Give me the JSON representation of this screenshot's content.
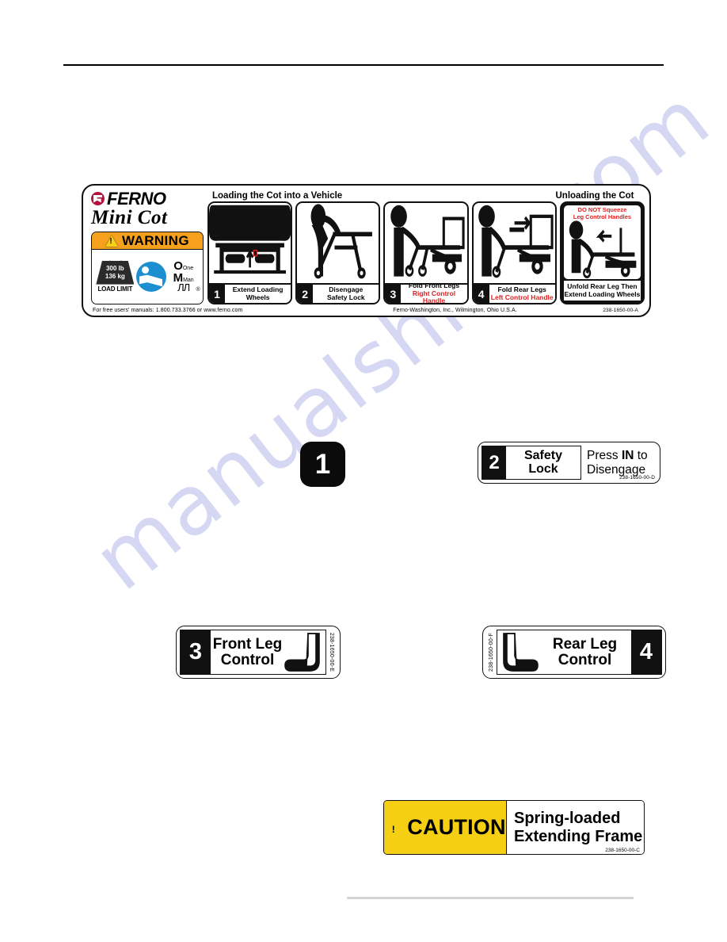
{
  "page": {
    "watermark": "manualshive.com"
  },
  "main_decal": {
    "brand": {
      "logo_icon": "ferno-logo-icon",
      "brand_name": "FERNO",
      "product_name": "Mini Cot",
      "warning": {
        "warning_icon": "warning-triangle-icon",
        "word": "WARNING",
        "load_weight_lb": "300 lb",
        "load_weight_kg": "136 kg",
        "load_limit_label": "LOAD LIMIT",
        "read_manual_icon": "read-manual-icon",
        "one_man_mark": {
          "line1": "One",
          "line2": "Man",
          "registered": "®"
        }
      }
    },
    "headings": {
      "loading": "Loading the Cot into a Vehicle",
      "unloading": "Unloading the Cot"
    },
    "panels": [
      {
        "number": "1",
        "caption_line1": "Extend Loading",
        "caption_line2": "Wheels",
        "caption_red": "",
        "illustration": "cot-loading-wheels-front-view"
      },
      {
        "number": "2",
        "caption_line1": "Disengage",
        "caption_line2": "Safety Lock",
        "caption_red": "",
        "illustration": "operator-disengaging-safety-lock"
      },
      {
        "number": "3",
        "caption_line1": "Fold Front Legs",
        "caption_line2": "",
        "caption_red": "Right Control Handle",
        "illustration": "operator-folding-front-legs"
      },
      {
        "number": "4",
        "caption_line1": "Fold Rear Legs",
        "caption_line2": "",
        "caption_red": "Left Control Handle",
        "illustration": "operator-folding-rear-legs"
      },
      {
        "number": "",
        "caption_line1": "Unfold Rear Leg Then",
        "caption_line2": "Extend Loading Wheels",
        "caption_red": "",
        "illustration": "operator-unloading-cot",
        "warning_red_line1": "DO NOT Squeeze",
        "warning_red_line2": "Leg Control Handles"
      }
    ],
    "footer": {
      "manuals": "For free users' manuals: 1.800.733.3766 or www.ferno.com",
      "company": "Ferno-Washington, Inc., Wilmington, Ohio  U.S.A.",
      "part_number": "238-1650-00-A"
    }
  },
  "badge_one": {
    "number": "1"
  },
  "safety_lock_decal": {
    "number": "2",
    "label_line1": "Safety",
    "label_line2": "Lock",
    "instruction_line1_pre": "Press ",
    "instruction_line1_bold": "IN",
    "instruction_line1_post": " to",
    "instruction_line2": "Disengage",
    "part_number": "238-1650-00-D"
  },
  "front_leg_decal": {
    "number": "3",
    "label_line1": "Front Leg",
    "label_line2": "Control",
    "hook_icon": "front-leg-hook-icon",
    "part_number": "238-1650-00-E"
  },
  "rear_leg_decal": {
    "number": "4",
    "label_line1": "Rear Leg",
    "label_line2": "Control",
    "hook_icon": "rear-leg-hook-icon",
    "part_number": "238-1650-00-F"
  },
  "caution_decal": {
    "caution_icon": "caution-triangle-icon",
    "word": "CAUTION",
    "message_line1": "Spring-loaded",
    "message_line2": "Extending Frame",
    "part_number": "238-1650-00-C"
  },
  "colors": {
    "warning_orange": "#f5a11e",
    "caution_yellow": "#f5cf14",
    "alert_red": "#e02020",
    "brand_crimson": "#b4123f",
    "manual_blue": "#1c8fd1",
    "watermark": "#9296dc"
  }
}
